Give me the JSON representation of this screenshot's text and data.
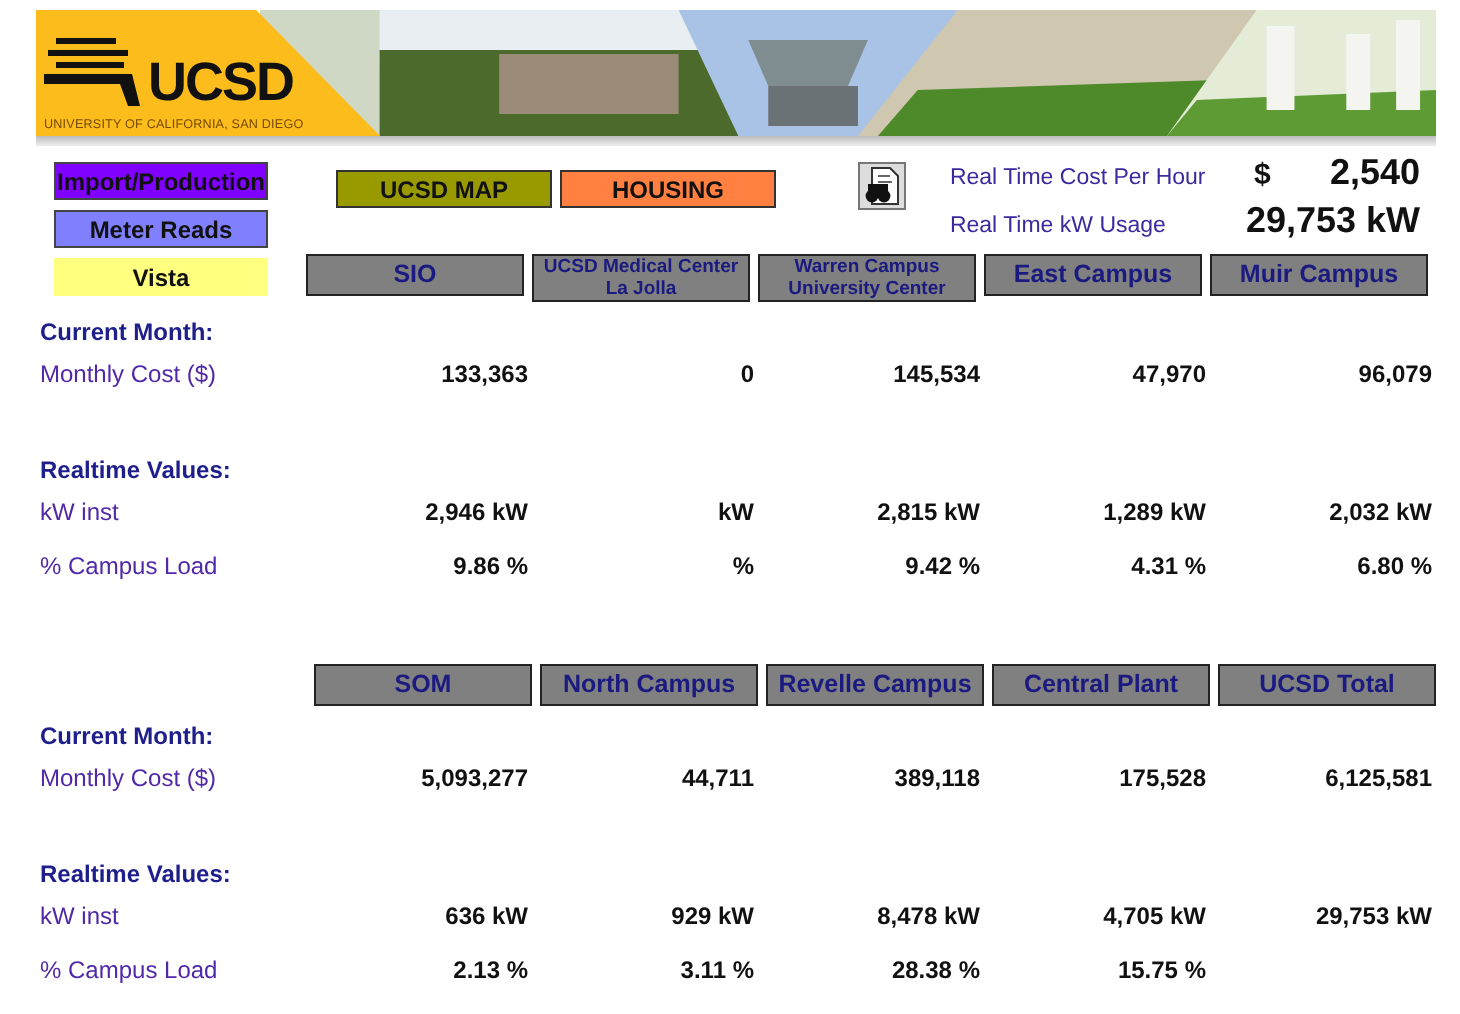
{
  "banner": {
    "wordmark": "UCSD",
    "subtitle": "UNIVERSITY OF CALIFORNIA, SAN DIEGO"
  },
  "nav_buttons": [
    {
      "label": "Import/Production",
      "color": "#8000ff"
    },
    {
      "label": "Meter Reads",
      "color": "#8080ff"
    },
    {
      "label": "Vista",
      "color": "#ffff80"
    }
  ],
  "toolbar_buttons": [
    {
      "label": "UCSD MAP",
      "color": "#999900"
    },
    {
      "label": "HOUSING",
      "color": "#ff8040"
    }
  ],
  "readouts": [
    {
      "label": "Real Time Cost Per Hour",
      "currency": "$",
      "value": "2,540"
    },
    {
      "label": "Real Time kW Usage",
      "value": "29,753 kW"
    }
  ],
  "sections": [
    {
      "columns": [
        "SIO",
        "UCSD Medical Center\nLa Jolla",
        "Warren Campus\nUniversity Center",
        "East Campus",
        "Muir Campus"
      ],
      "groups": [
        {
          "heading": "Current Month:",
          "rows": [
            {
              "label": "Monthly Cost ($)",
              "values": [
                "133,363",
                "0",
                "145,534",
                "47,970",
                "96,079"
              ]
            }
          ]
        },
        {
          "heading": "Realtime Values:",
          "rows": [
            {
              "label": "kW inst",
              "values": [
                "2,946 kW",
                "kW",
                "2,815 kW",
                "1,289 kW",
                "2,032 kW"
              ]
            },
            {
              "label": "% Campus Load",
              "values": [
                "9.86 %",
                "%",
                "9.42 %",
                "4.31 %",
                "6.80 %"
              ]
            }
          ]
        }
      ]
    },
    {
      "columns": [
        "SOM",
        "North Campus",
        "Revelle Campus",
        "Central Plant",
        "UCSD Total"
      ],
      "groups": [
        {
          "heading": "Current Month:",
          "rows": [
            {
              "label": "Monthly Cost ($)",
              "values": [
                "5,093,277",
                "44,711",
                "389,118",
                "175,528",
                "6,125,581"
              ]
            }
          ]
        },
        {
          "heading": "Realtime Values:",
          "rows": [
            {
              "label": "kW inst",
              "values": [
                "636 kW",
                "929 kW",
                "8,478 kW",
                "4,705 kW",
                "29,753 kW"
              ]
            },
            {
              "label": "% Campus Load",
              "values": [
                "2.13 %",
                "3.11 %",
                "28.38 %",
                "15.75 %"
              ]
            }
          ]
        }
      ]
    }
  ]
}
